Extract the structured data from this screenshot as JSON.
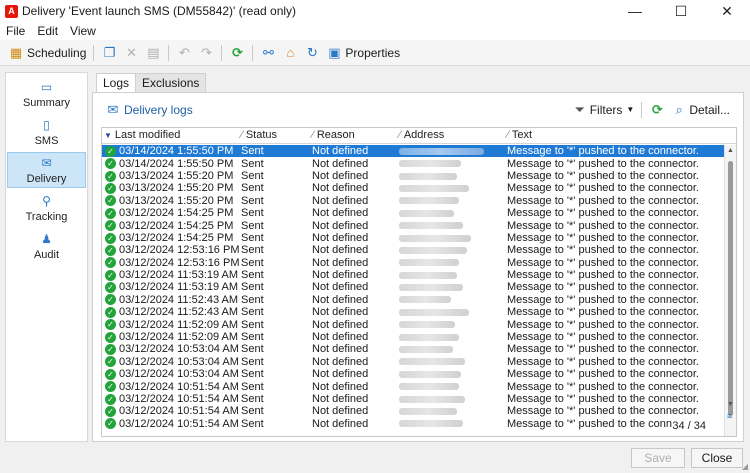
{
  "window": {
    "title": "Delivery 'Event launch SMS (DM55842)' (read only)",
    "app_icon_letter": "A",
    "controls": [
      "—",
      "☐",
      "✕"
    ]
  },
  "menu": [
    "File",
    "Edit",
    "View"
  ],
  "toolbar": {
    "scheduling_label": "Scheduling",
    "properties_label": "Properties"
  },
  "sidebar": {
    "items": [
      {
        "label": "Summary",
        "icon": "summary-icon",
        "glyph": "▭",
        "active": false
      },
      {
        "label": "SMS",
        "icon": "phone-icon",
        "glyph": "▯",
        "active": false
      },
      {
        "label": "Delivery",
        "icon": "delivery-icon",
        "glyph": "✉",
        "active": true
      },
      {
        "label": "Tracking",
        "icon": "tracking-icon",
        "glyph": "⚲",
        "active": false
      },
      {
        "label": "Audit",
        "icon": "audit-icon",
        "glyph": "♟",
        "active": false
      }
    ]
  },
  "tabs": [
    "Logs",
    "Exclusions"
  ],
  "panel": {
    "delivery_logs_label": "Delivery logs",
    "filters_label": "Filters",
    "detail_label": "Detail..."
  },
  "grid": {
    "columns": [
      "Last modified",
      "Status",
      "Reason",
      "Address",
      "Text"
    ],
    "rows": [
      {
        "modified": "03/14/2024 1:55:50 PM",
        "status": "Sent",
        "reason": "Not defined",
        "text": "Message to '*' pushed to the connector.",
        "selected": true
      },
      {
        "modified": "03/14/2024 1:55:50 PM",
        "status": "Sent",
        "reason": "Not defined",
        "text": "Message to '*' pushed to the connector.",
        "selected": false
      },
      {
        "modified": "03/13/2024 1:55:20 PM",
        "status": "Sent",
        "reason": "Not defined",
        "text": "Message to '*' pushed to the connector.",
        "selected": false
      },
      {
        "modified": "03/13/2024 1:55:20 PM",
        "status": "Sent",
        "reason": "Not defined",
        "text": "Message to '*' pushed to the connector.",
        "selected": false
      },
      {
        "modified": "03/13/2024 1:55:20 PM",
        "status": "Sent",
        "reason": "Not defined",
        "text": "Message to '*' pushed to the connector.",
        "selected": false
      },
      {
        "modified": "03/12/2024 1:54:25 PM",
        "status": "Sent",
        "reason": "Not defined",
        "text": "Message to '*' pushed to the connector.",
        "selected": false
      },
      {
        "modified": "03/12/2024 1:54:25 PM",
        "status": "Sent",
        "reason": "Not defined",
        "text": "Message to '*' pushed to the connector.",
        "selected": false
      },
      {
        "modified": "03/12/2024 1:54:25 PM",
        "status": "Sent",
        "reason": "Not defined",
        "text": "Message to '*' pushed to the connector.",
        "selected": false
      },
      {
        "modified": "03/12/2024 12:53:16 PM",
        "status": "Sent",
        "reason": "Not defined",
        "text": "Message to '*' pushed to the connector.",
        "selected": false
      },
      {
        "modified": "03/12/2024 12:53:16 PM",
        "status": "Sent",
        "reason": "Not defined",
        "text": "Message to '*' pushed to the connector.",
        "selected": false
      },
      {
        "modified": "03/12/2024 11:53:19 AM",
        "status": "Sent",
        "reason": "Not defined",
        "text": "Message to '*' pushed to the connector.",
        "selected": false
      },
      {
        "modified": "03/12/2024 11:53:19 AM",
        "status": "Sent",
        "reason": "Not defined",
        "text": "Message to '*' pushed to the connector.",
        "selected": false
      },
      {
        "modified": "03/12/2024 11:52:43 AM",
        "status": "Sent",
        "reason": "Not defined",
        "text": "Message to '*' pushed to the connector.",
        "selected": false
      },
      {
        "modified": "03/12/2024 11:52:43 AM",
        "status": "Sent",
        "reason": "Not defined",
        "text": "Message to '*' pushed to the connector.",
        "selected": false
      },
      {
        "modified": "03/12/2024 11:52:09 AM",
        "status": "Sent",
        "reason": "Not defined",
        "text": "Message to '*' pushed to the connector.",
        "selected": false
      },
      {
        "modified": "03/12/2024 11:52:09 AM",
        "status": "Sent",
        "reason": "Not defined",
        "text": "Message to '*' pushed to the connector.",
        "selected": false
      },
      {
        "modified": "03/12/2024 10:53:04 AM",
        "status": "Sent",
        "reason": "Not defined",
        "text": "Message to '*' pushed to the connector.",
        "selected": false
      },
      {
        "modified": "03/12/2024 10:53:04 AM",
        "status": "Sent",
        "reason": "Not defined",
        "text": "Message to '*' pushed to the connector.",
        "selected": false
      },
      {
        "modified": "03/12/2024 10:53:04 AM",
        "status": "Sent",
        "reason": "Not defined",
        "text": "Message to '*' pushed to the connector.",
        "selected": false
      },
      {
        "modified": "03/12/2024 10:51:54 AM",
        "status": "Sent",
        "reason": "Not defined",
        "text": "Message to '*' pushed to the connector.",
        "selected": false
      },
      {
        "modified": "03/12/2024 10:51:54 AM",
        "status": "Sent",
        "reason": "Not defined",
        "text": "Message to '*' pushed to the connector.",
        "selected": false
      },
      {
        "modified": "03/12/2024 10:51:54 AM",
        "status": "Sent",
        "reason": "Not defined",
        "text": "Message to '*' pushed to the connector.",
        "selected": false
      },
      {
        "modified": "03/12/2024 10:51:54 AM",
        "status": "Sent",
        "reason": "Not defined",
        "text": "Message to '*' pushed to the connector.",
        "selected": false
      }
    ],
    "count_label": "34 / 34"
  },
  "footer": {
    "save_label": "Save",
    "close_label": "Close"
  },
  "colors": {
    "selection": "#1f7ad6",
    "success": "#23a43b",
    "link": "#1f5fa8",
    "brand": "#e3170a"
  }
}
